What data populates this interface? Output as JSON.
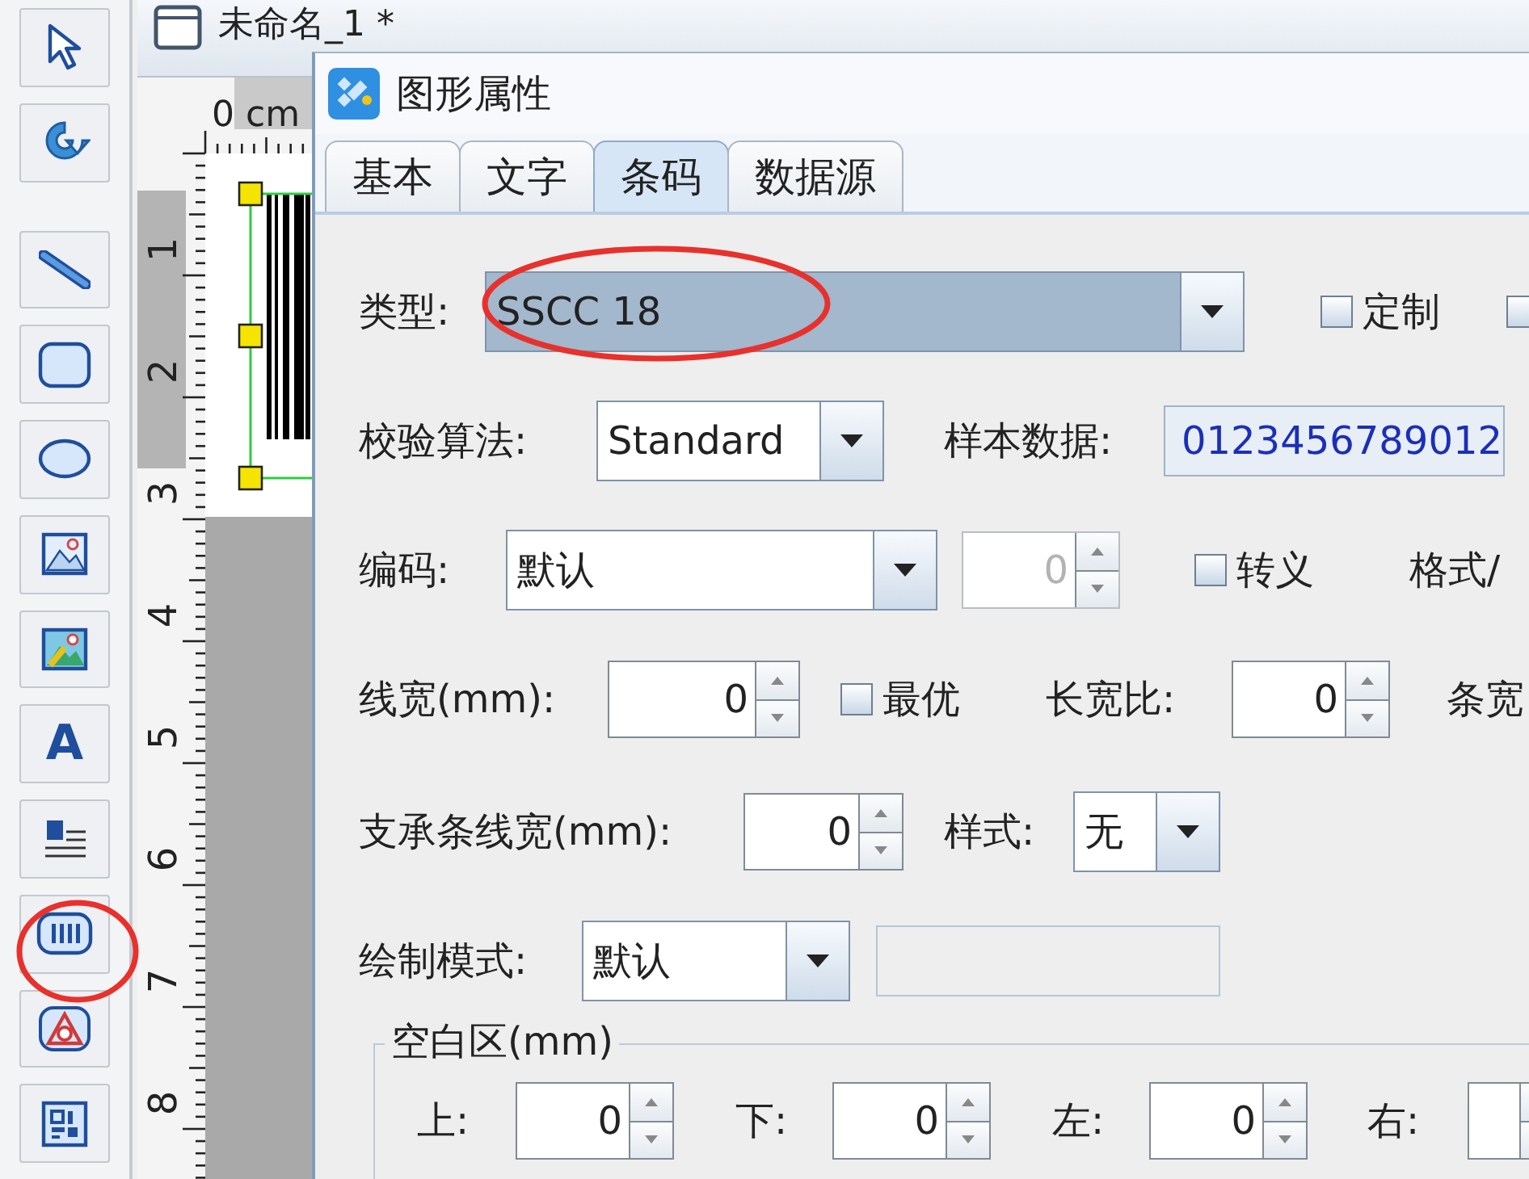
{
  "toolbar": {
    "tools": [
      {
        "kind": "pointer"
      },
      {
        "kind": "rotate"
      },
      {
        "kind": "line"
      },
      {
        "kind": "rounded-rect"
      },
      {
        "kind": "ellipse"
      },
      {
        "kind": "image"
      },
      {
        "kind": "color-image"
      },
      {
        "kind": "text",
        "label": "A"
      },
      {
        "kind": "rich-text"
      },
      {
        "kind": "barcode",
        "circled": true
      },
      {
        "kind": "triangle"
      },
      {
        "kind": "qrcode"
      }
    ]
  },
  "document": {
    "tab_title": "未命名_1 *",
    "ruler": {
      "unit_label": "0 cm",
      "marks": [
        "1",
        "2",
        "3",
        "4",
        "5",
        "6",
        "7",
        "8"
      ]
    }
  },
  "dialog": {
    "title": "图形属性",
    "tabs": [
      {
        "label": "基本",
        "selected": false
      },
      {
        "label": "文字",
        "selected": false
      },
      {
        "label": "条码",
        "selected": true
      },
      {
        "label": "数据源",
        "selected": false
      }
    ],
    "form_lines": [
      {
        "controls": [
          {
            "kind": "label",
            "text": "类型:"
          },
          {
            "kind": "combo",
            "value": "SSCC 18",
            "focused": true,
            "circled": true
          },
          {
            "kind": "checkbox",
            "label": "定制",
            "checked": false
          },
          {
            "kind": "checkbox",
            "checked": false
          }
        ]
      },
      {
        "controls": [
          {
            "kind": "label",
            "text": "校验算法:"
          },
          {
            "kind": "combo",
            "value": "Standard",
            "focused": false
          },
          {
            "kind": "label",
            "text": "样本数据:"
          },
          {
            "kind": "field",
            "value": "0123456789012",
            "disabled": false
          }
        ]
      },
      {
        "controls": [
          {
            "kind": "label",
            "text": "编码:"
          },
          {
            "kind": "combo",
            "value": "默认",
            "focused": false
          },
          {
            "kind": "spinner",
            "value": "0",
            "disabled": true
          },
          {
            "kind": "checkbox",
            "label": "转义",
            "checked": false
          },
          {
            "kind": "label",
            "text": "格式/"
          }
        ]
      },
      {
        "controls": [
          {
            "kind": "label",
            "text": "线宽(mm):"
          },
          {
            "kind": "spinner",
            "value": "0",
            "disabled": false
          },
          {
            "kind": "checkbox",
            "label": "最优",
            "checked": false
          },
          {
            "kind": "label",
            "text": "长宽比:"
          },
          {
            "kind": "spinner",
            "value": "0",
            "disabled": false
          },
          {
            "kind": "label",
            "text": "条宽"
          }
        ]
      },
      {
        "controls": [
          {
            "kind": "label",
            "text": "支承条线宽(mm):"
          },
          {
            "kind": "spinner",
            "value": "0",
            "disabled": false
          },
          {
            "kind": "label",
            "text": "样式:"
          },
          {
            "kind": "combo",
            "value": "无",
            "focused": false
          }
        ]
      },
      {
        "controls": [
          {
            "kind": "label",
            "text": "绘制模式:"
          },
          {
            "kind": "combo",
            "value": "默认",
            "focused": false
          },
          {
            "kind": "field",
            "disabled": true
          }
        ]
      }
    ],
    "margin_group": {
      "legend": "空白区(mm)",
      "items": [
        {
          "kind": "label",
          "text": "上:"
        },
        {
          "kind": "spinner",
          "value": "0",
          "disabled": false
        },
        {
          "kind": "label",
          "text": "下:"
        },
        {
          "kind": "spinner",
          "value": "0",
          "disabled": false
        },
        {
          "kind": "label",
          "text": "左:"
        },
        {
          "kind": "spinner",
          "value": "0",
          "disabled": false
        },
        {
          "kind": "label",
          "text": "右:"
        },
        {
          "kind": "spinner",
          "disabled": false
        }
      ]
    }
  }
}
